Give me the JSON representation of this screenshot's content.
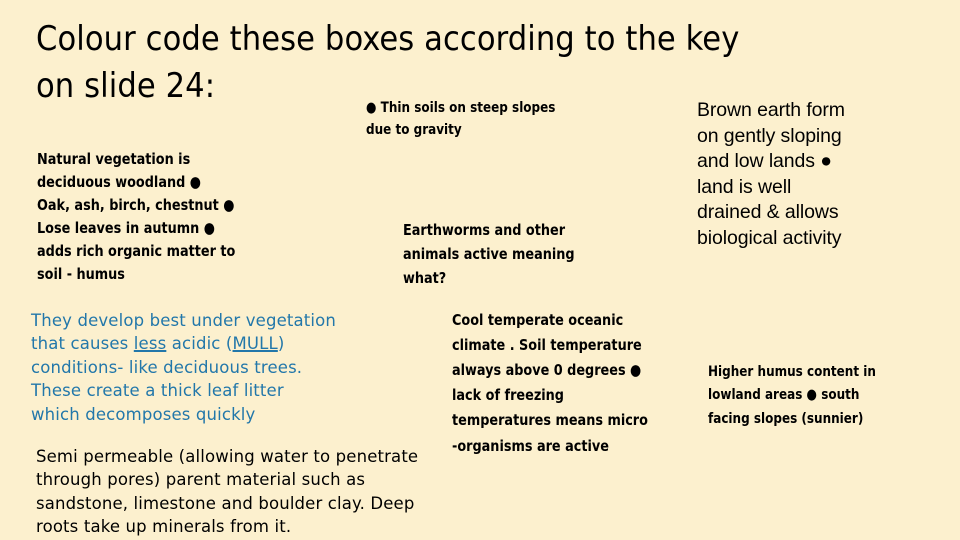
{
  "slide": {
    "background_color": "#FCF0CE",
    "title": "Colour code these boxes according to the key\non slide 24:",
    "accent_color": "#2277AA",
    "text_color": "#000000"
  },
  "blocks": {
    "vegetation": "Natural vegetation is\ndeciduous woodland ●\nOak, ash, birch, chestnut ●\nLose leaves in autumn ●\nadds rich organic matter to\nsoil - humus",
    "thin_soils": "● Thin soils on steep slopes\ndue to gravity",
    "earthworms": "Earthworms and other\nanimals active meaning\nwhat?",
    "climate": "Cool temperate oceanic\nclimate . Soil temperature\nalways above 0 degrees ●\nlack of freezing\ntemperatures means micro\n-organisms are active",
    "brown_earth": "Brown earth form\non gently sloping\nand low lands ●\nland is well\ndrained & allows\nbiological activity",
    "higher_humus": "Higher humus content in\nlowland areas ● south\nfacing slopes (sunnier)",
    "mull": {
      "part1": "They develop best under vegetation\nthat causes ",
      "underline1": "less",
      "part2": " acidic (",
      "underline2": "MULL",
      "part3": ")\nconditions- like deciduous trees.\nThese create a thick leaf litter\nwhich decomposes quickly"
    },
    "permeable": "Semi permeable (allowing water to penetrate\nthrough pores) parent material such as\nsandstone, limestone and boulder clay. Deep\nroots take up minerals from it."
  }
}
